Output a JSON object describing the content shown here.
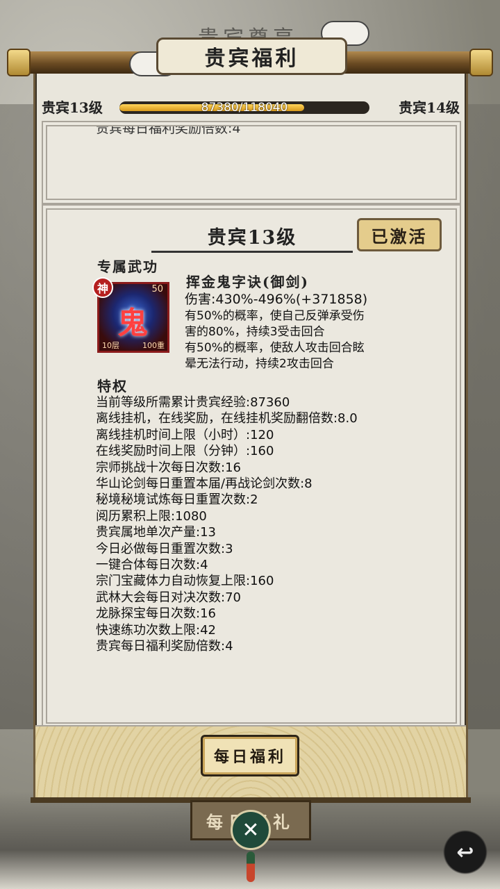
{
  "header": {
    "title": "贵宾福利",
    "background_title": "贵宾尊享"
  },
  "vip_progress": {
    "current_level_label": "贵宾13级",
    "next_level_label": "贵宾14级",
    "progress_text": "87380/118040",
    "current": 87380,
    "target": 118040,
    "fill_fraction": 0.74
  },
  "previous_card": {
    "cut_text": "贵宾每日福利奖励倍数:4"
  },
  "level_card": {
    "title": "贵宾13级",
    "status_button": "已激活",
    "exclusive_skill_heading": "专属武功",
    "skill": {
      "icon_tier_badge": "神",
      "icon_glyph": "鬼",
      "icon_level": "50",
      "icon_layers": "10层",
      "icon_count": "100重",
      "name": "挥金鬼字诀(御剑)",
      "damage": "伤害:430%-496%(+371858)",
      "effect_lines": [
        "有50%的概率，使自己反弹承受伤",
        "害的80%，持续3受击回合",
        "有50%的概率，使敌人攻击回合眩",
        "晕无法行动，持续2攻击回合"
      ]
    },
    "privileges_heading": "特权",
    "privileges": [
      "当前等级所需累计贵宾经验:87360",
      "离线挂机，在线奖励，在线挂机奖励翻倍数:8.0",
      "离线挂机时间上限（小时）:120",
      "在线奖励时间上限（分钟）:160",
      "宗师挑战十次每日次数:16",
      "华山论剑每日重置本届/再战论剑次数:8",
      "秘境秘境试炼每日重置次数:2",
      "阅历累积上限:1080",
      "贵宾属地单次产量:13",
      "今日必做每日重置次数:3",
      "一键合体每日次数:4",
      "宗门宝藏体力自动恢复上限:160",
      "武林大会每日对决次数:70",
      "龙脉探宝每日次数:16",
      "快速练功次数上限:42",
      "贵宾每日福利奖励倍数:4"
    ]
  },
  "footer": {
    "daily_button": "每日福利",
    "gift_plaque": "每日好礼",
    "close_symbol": "✕",
    "back_symbol": "↩"
  }
}
